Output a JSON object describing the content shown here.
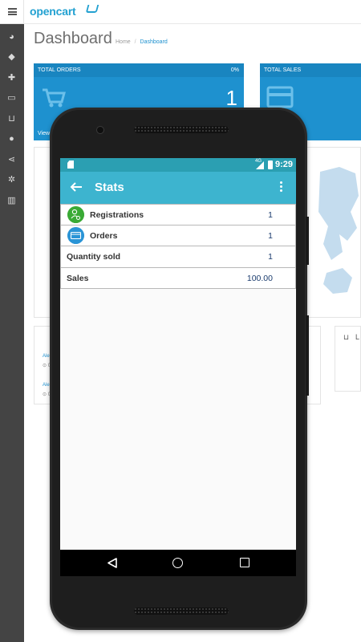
{
  "background_app": {
    "brand": "opencart",
    "page_title": "Dashboard",
    "breadcrumb": {
      "home": "Home",
      "separator": "/",
      "current": "Dashboard"
    },
    "tiles": [
      {
        "title": "TOTAL ORDERS",
        "percent": "0%",
        "value": "1",
        "link": "View"
      },
      {
        "title": "TOTAL SALES"
      }
    ],
    "activity": [
      {
        "link": "Ale",
        "sub": "⊙ 0"
      },
      {
        "link": "Ale",
        "sub": "⊙ 0"
      }
    ],
    "latest_panel_label": "L",
    "rail_icons": [
      "dashboard-icon",
      "tag-icon",
      "puzzle-icon",
      "monitor-icon",
      "cart-icon",
      "user-icon",
      "share-icon",
      "gear-icon",
      "bar-chart-icon"
    ],
    "colors": {
      "rail": "#444444",
      "tile": "#1e91cf",
      "brand": "#23a1d1"
    }
  },
  "phone": {
    "status_bar": {
      "network": "4G",
      "time": "9:29"
    },
    "toolbar": {
      "title": "Stats"
    },
    "stats": [
      {
        "label": "Registrations",
        "value": "1",
        "icon": "user-add-icon"
      },
      {
        "label": "Orders",
        "value": "1",
        "icon": "credit-card-icon"
      },
      {
        "label": "Quantity sold",
        "value": "1"
      },
      {
        "label": "Sales",
        "value": "100.00"
      }
    ],
    "colors": {
      "status_bar": "#2b9fb2",
      "toolbar": "#3db4cf",
      "value_text": "#1b3c6e"
    }
  }
}
